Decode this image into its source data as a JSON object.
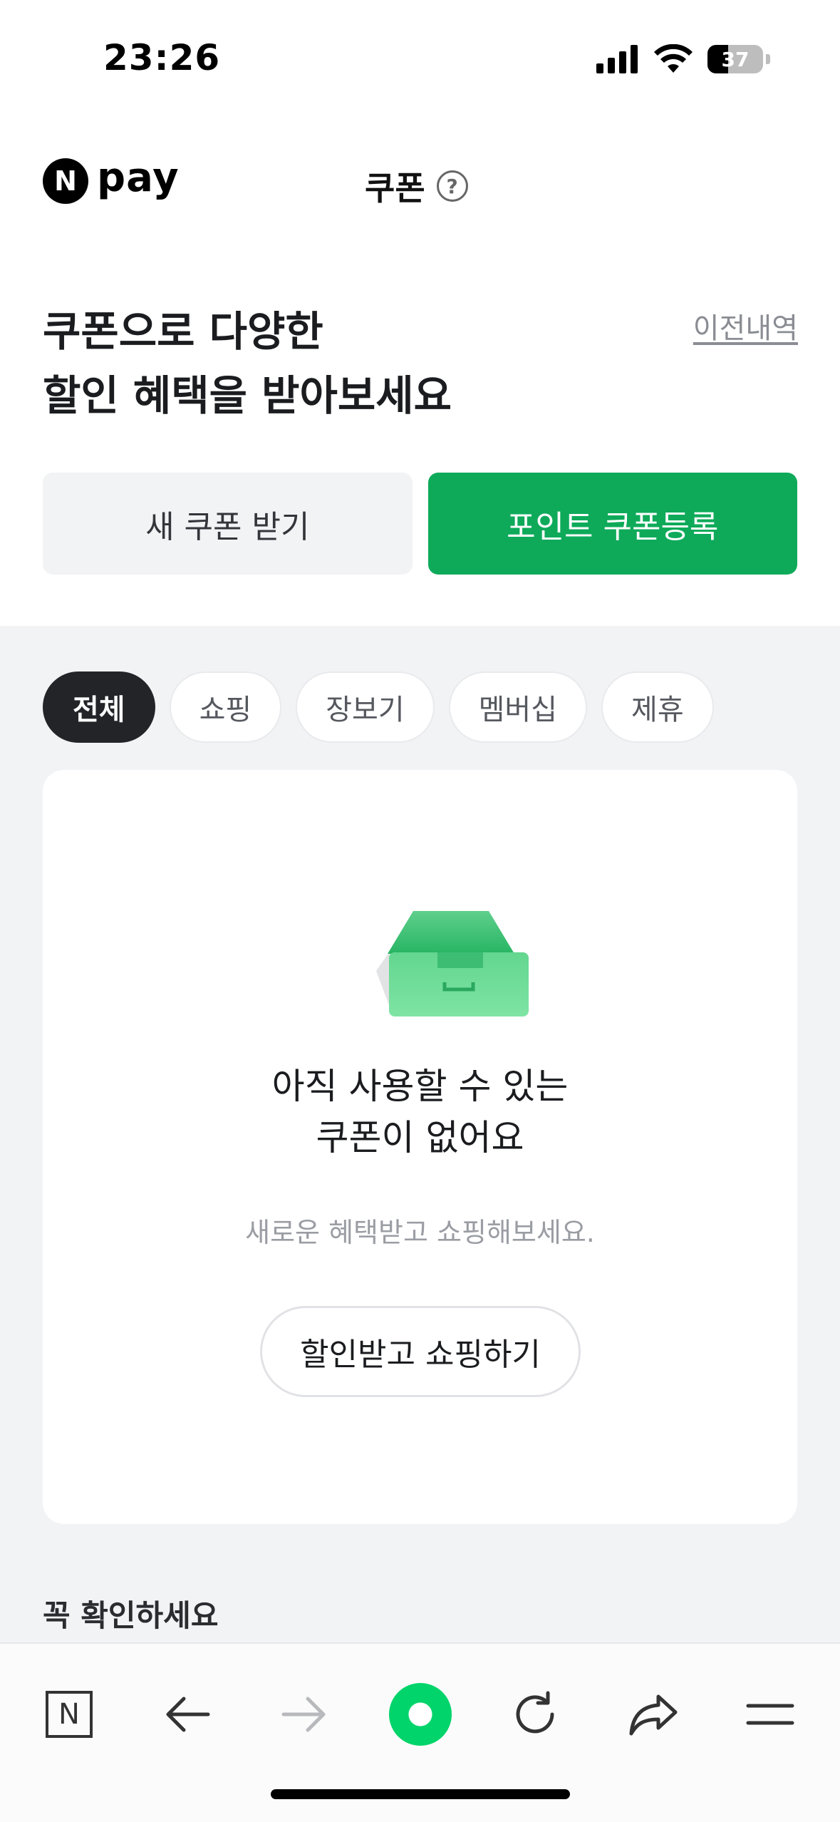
{
  "status_bar": {
    "time": "23:26",
    "battery": "37",
    "battery_level": 0.37,
    "icons": [
      "cellular-signal-icon",
      "wifi-icon",
      "battery-icon"
    ]
  },
  "header": {
    "logo_mark": "N",
    "logo_text": "pay",
    "title": "쿠폰",
    "help_icon": "?"
  },
  "hero": {
    "title_line1": "쿠폰으로 다양한",
    "title_line2": "할인 혜택을 받아보세요",
    "history_link": "이전내역"
  },
  "buttons": {
    "new_coupon": "새 쿠폰 받기",
    "register_point_coupon": "포인트 쿠폰등록"
  },
  "filters": {
    "items": [
      "전체",
      "쇼핑",
      "장보기",
      "멤버십",
      "제휴"
    ],
    "selected": "전체"
  },
  "empty_state": {
    "title_line1": "아직 사용할 수 있는",
    "title_line2": "쿠폰이 없어요",
    "subtitle": "새로운 혜택받고 쇼핑해보세요.",
    "cta": "할인받고 쇼핑하기"
  },
  "section": {
    "check_title": "꼭 확인하세요"
  },
  "toolbar": {
    "items": [
      "naver-home-icon",
      "back-arrow-icon",
      "forward-arrow-icon",
      "green-dot-icon",
      "refresh-icon",
      "share-icon",
      "menu-icon"
    ],
    "home_label": "N"
  },
  "colors": {
    "accent_green": "#0eaa5a",
    "chip_active": "#222428",
    "section_bg": "#f2f3f5"
  }
}
